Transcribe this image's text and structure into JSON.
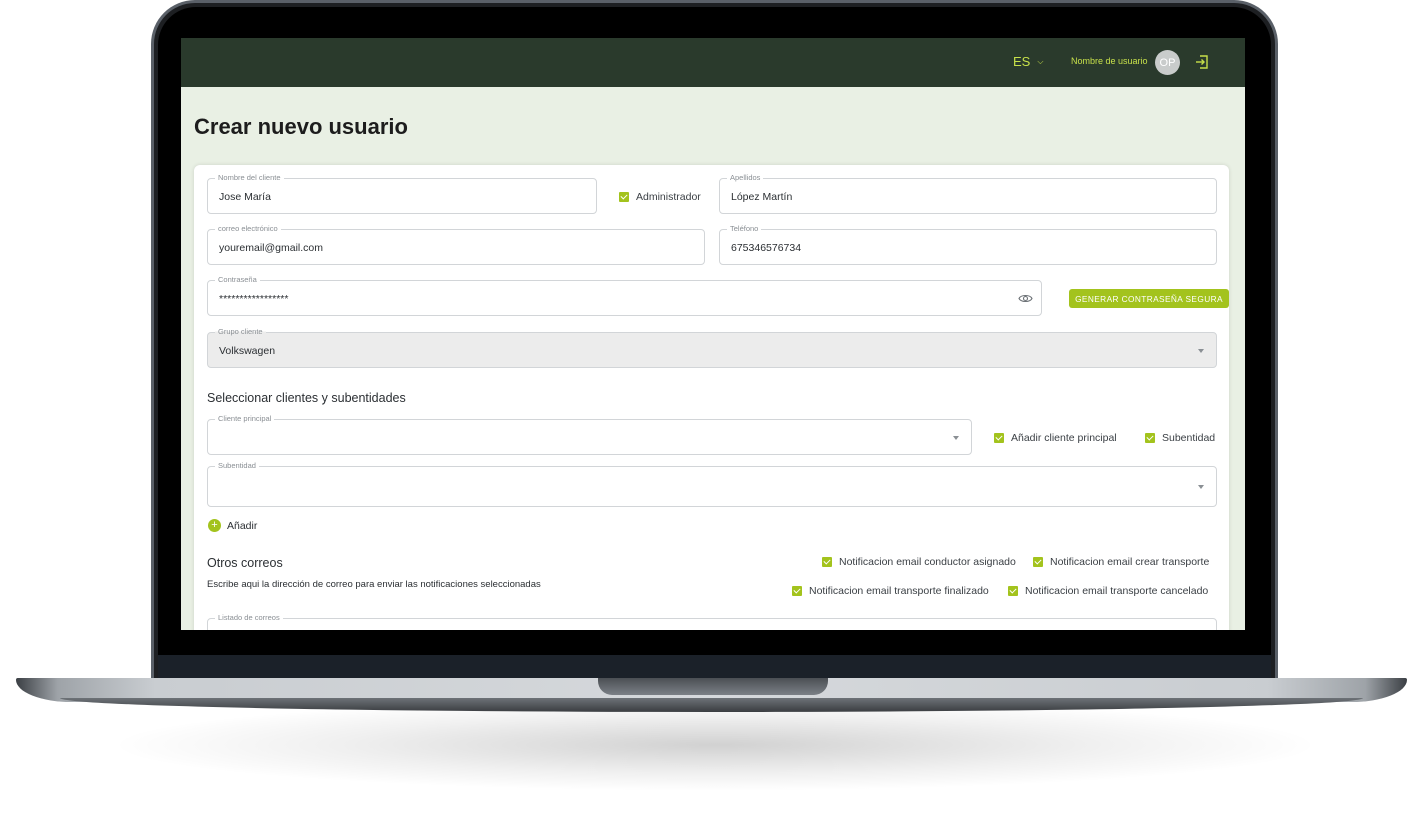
{
  "header": {
    "language": "ES",
    "username": "Nombre de usuario",
    "avatar_initials": "OP"
  },
  "page": {
    "title": "Crear nuevo usuario"
  },
  "form": {
    "nombre": {
      "label": "Nombre del cliente",
      "value": "Jose María"
    },
    "administrador": {
      "label": "Administrador",
      "checked": true
    },
    "apellidos": {
      "label": "Apellidos",
      "value": "López Martín"
    },
    "correo": {
      "label": "correo electrónico",
      "value": "youremail@gmail.com"
    },
    "telefono": {
      "label": "Teléfono",
      "value": "675346576734"
    },
    "contrasena": {
      "label": "Contraseña",
      "value": "*****************"
    },
    "generar_label": "GENERAR CONTRASEÑA SEGURA",
    "grupo": {
      "label": "Grupo cliente",
      "value": "Volkswagen"
    }
  },
  "clientes": {
    "title": "Seleccionar clientes y subentidades",
    "cliente_principal": {
      "label": "Cliente principal",
      "value": ""
    },
    "anadir_principal": {
      "label": "Añadir cliente principal",
      "checked": true
    },
    "subentidad_check": {
      "label": "Subentidad",
      "checked": true
    },
    "subentidad": {
      "label": "Subentidad",
      "value": ""
    },
    "add_label": "Añadir"
  },
  "correos": {
    "title": "Otros correos",
    "hint": "Escribe aqui la dirección de correo para enviar las notificaciones seleccionadas",
    "notif_conductor": {
      "label": "Notificacion email conductor asignado",
      "checked": true
    },
    "notif_crear": {
      "label": "Notificacion email crear transporte",
      "checked": true
    },
    "notif_finalizado": {
      "label": "Notificacion email transporte finalizado",
      "checked": true
    },
    "notif_cancelado": {
      "label": "Notificacion email transporte cancelado",
      "checked": true
    },
    "listado": {
      "label": "Listado de correos",
      "value": ""
    }
  },
  "colors": {
    "topbar": "#2a3a2c",
    "accent": "#a3c31d",
    "header_text": "#c7e04a",
    "page_bg": "#e9f0e4"
  }
}
